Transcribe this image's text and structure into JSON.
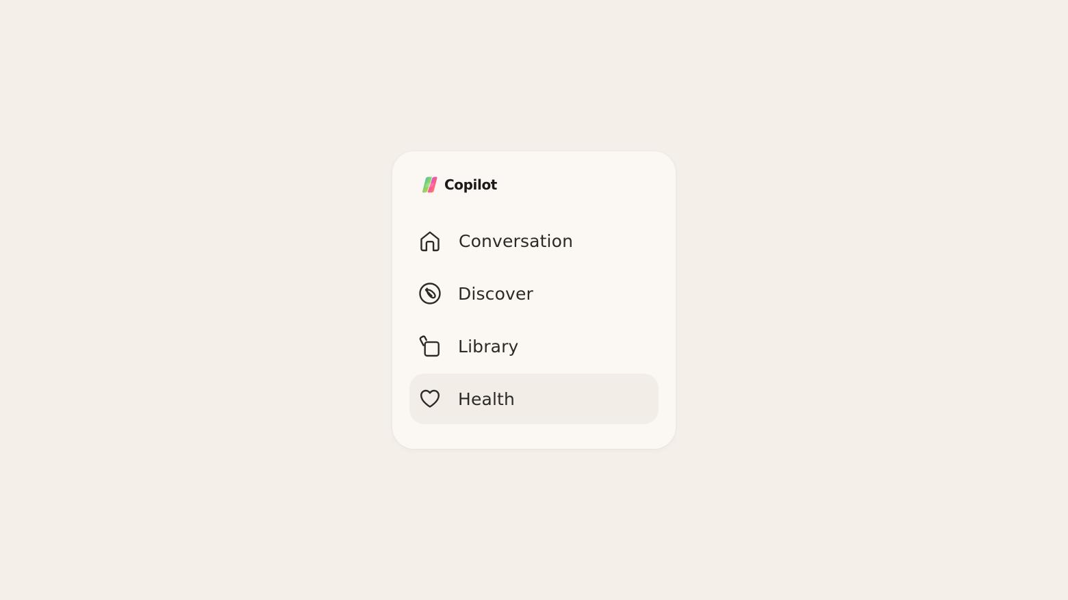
{
  "colors": {
    "page_background": "#f4efe8",
    "panel_background": "#fbf8f3",
    "active_item_background": "#f2ede7",
    "text": "#2d2925"
  },
  "brand": {
    "name": "Copilot",
    "logo_icon": "copilot-logo-icon"
  },
  "nav": {
    "items": [
      {
        "label": "Conversation",
        "icon": "home-icon",
        "active": false
      },
      {
        "label": "Discover",
        "icon": "compass-icon",
        "active": false
      },
      {
        "label": "Library",
        "icon": "library-icon",
        "active": false
      },
      {
        "label": "Health",
        "icon": "heart-icon",
        "active": true
      }
    ]
  }
}
